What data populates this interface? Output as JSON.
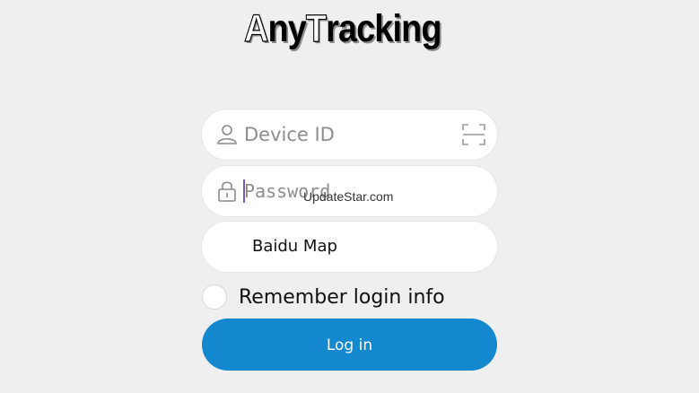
{
  "logo": {
    "part1": "A",
    "part2": "ny",
    "part3": "T",
    "part4": "racking"
  },
  "form": {
    "device_id_placeholder": "Device ID",
    "password_placeholder": "Password",
    "map_selected": "Baidu Map",
    "remember_label": "Remember login info",
    "remember_checked": false,
    "login_label": "Log in"
  },
  "watermark": "UpdateStar.com",
  "icons": {
    "device": "user-icon",
    "scan": "scan-icon",
    "password": "lock-icon"
  },
  "colors": {
    "background": "#efefef",
    "login_button": "#1388cf",
    "field_background": "#ffffff"
  }
}
